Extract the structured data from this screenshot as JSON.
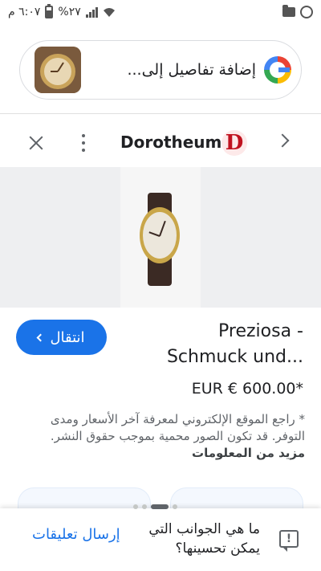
{
  "status_bar": {
    "time": "٦:٠٧ م",
    "battery": "%٢٧",
    "icons": [
      "battery-icon",
      "signal-icon",
      "wifi-icon",
      "folder-icon",
      "whatsapp-icon"
    ]
  },
  "search_bar": {
    "query_text": "إضافة تفاصيل إلى...",
    "icons": [
      "google-lens-icon",
      "thumbnail-image"
    ]
  },
  "source": {
    "name": "Dorotheum",
    "logo_letter": "D",
    "logo_color": "#c0121f",
    "icons": [
      "close-icon",
      "more-vert-icon",
      "chevron-right-icon"
    ]
  },
  "result": {
    "title_line1": "Preziosa -",
    "title_line2": "Schmuck und...",
    "price": "EUR € 600.00*",
    "goto_label": "انتقال",
    "disclaimer": "* راجع الموقع الإلكتروني لمعرفة آخر الأسعار ومدى التوفر. قد تكون الصور محمية بموجب حقوق النشر.",
    "more_info": "مزيد من المعلومات"
  },
  "feedback": {
    "question": "ما هي الجوانب التي يمكن تحسينها؟",
    "send_label": "إرسال تعليقات"
  },
  "colors": {
    "accent": "#1a73e8",
    "brand_red": "#c0121f"
  }
}
